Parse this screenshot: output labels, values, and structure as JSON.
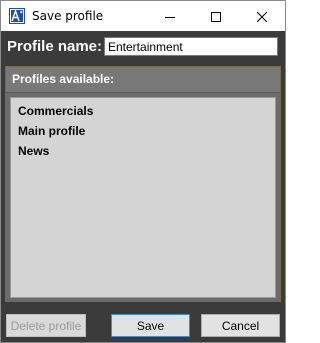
{
  "window": {
    "title": "Save profile"
  },
  "form": {
    "name_label": "Profile name:",
    "name_value": "Entertainment"
  },
  "profiles": {
    "header": "Profiles available:",
    "items": [
      "Commercials",
      "Main profile",
      "News"
    ]
  },
  "buttons": {
    "delete_label": "Delete profile",
    "save_label": "Save",
    "cancel_label": "Cancel"
  },
  "icons": {
    "app": "app-icon",
    "minimize": "minimize-icon",
    "maximize": "maximize-icon",
    "close": "close-icon"
  }
}
